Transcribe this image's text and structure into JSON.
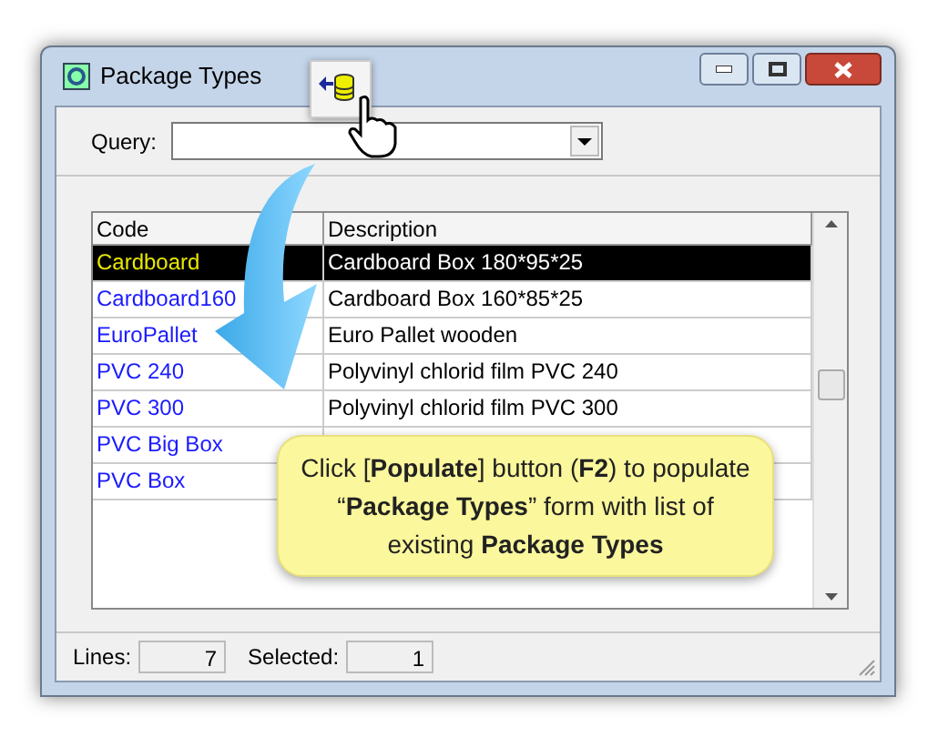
{
  "window": {
    "title": "Package Types"
  },
  "query": {
    "label": "Query:"
  },
  "table": {
    "columns": [
      "Code",
      "Description"
    ],
    "rows": [
      {
        "code": "Cardboard",
        "description": "Cardboard Box 180*95*25",
        "selected": true
      },
      {
        "code": "Cardboard160",
        "description": "Cardboard Box 160*85*25",
        "selected": false
      },
      {
        "code": "EuroPallet",
        "description": "Euro Pallet wooden",
        "selected": false
      },
      {
        "code": "PVC 240",
        "description": "Polyvinyl chlorid film PVC 240",
        "selected": false
      },
      {
        "code": "PVC 300",
        "description": "Polyvinyl chlorid film PVC 300",
        "selected": false
      },
      {
        "code": "PVC Big Box",
        "selected": false
      },
      {
        "code": "PVC Box",
        "selected": false
      }
    ]
  },
  "status_bar": {
    "lines_label": "Lines:",
    "lines": "7",
    "selected_label": "Selected:",
    "selected": "1"
  },
  "callout": {
    "text": "Click [**Populate**] button (**F2**) to populate “**Package Types**” form with list of existing **Package Types**"
  }
}
